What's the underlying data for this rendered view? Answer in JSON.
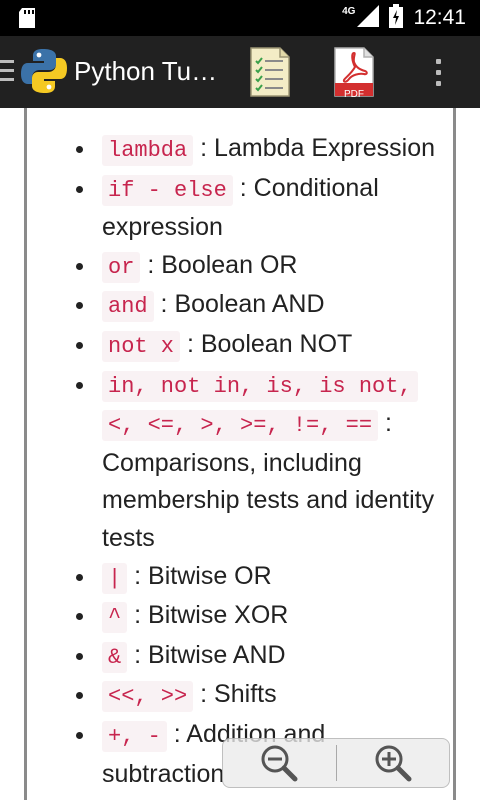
{
  "status_bar": {
    "network": "4G",
    "time": "12:41"
  },
  "action_bar": {
    "title": "Python Tu…",
    "pdf_label": "PDF"
  },
  "colors": {
    "code_text": "#c7254e",
    "code_bg": "#f9f2f4",
    "action_bar_bg": "#212121"
  },
  "operators": [
    {
      "code": "lambda",
      "text": " : Lambda Expression"
    },
    {
      "code": "if - else",
      "text": " : Conditional expression"
    },
    {
      "code": "or",
      "text": " : Boolean OR"
    },
    {
      "code": "and",
      "text": " : Boolean AND"
    },
    {
      "code": "not x",
      "text": " : Boolean NOT"
    },
    {
      "code": "in, not in, is, is not, <, <=, >, >=, !=, ==",
      "text": " : Comparisons, including membership tests and identity tests"
    },
    {
      "code": "|",
      "text": " : Bitwise OR"
    },
    {
      "code": "^",
      "text": " : Bitwise XOR"
    },
    {
      "code": "&",
      "text": " : Bitwise AND"
    },
    {
      "code": "<<, >>",
      "text": " : Shifts"
    },
    {
      "code": "+, -",
      "text": " : Addition and subtraction"
    }
  ]
}
